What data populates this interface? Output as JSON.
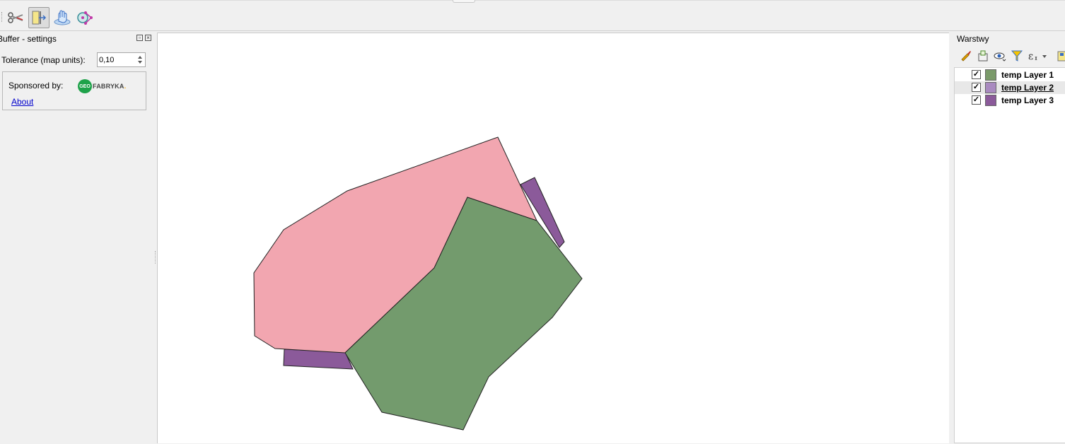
{
  "toolbar": {
    "buttons": [
      {
        "name": "scissors-icon"
      },
      {
        "name": "split-view-icon",
        "active": true
      },
      {
        "name": "touch-layer-icon"
      },
      {
        "name": "node-tool-icon"
      }
    ]
  },
  "buffer_panel": {
    "title": "Buffer - settings",
    "tolerance_label": "Tolerance (map units):",
    "tolerance_value": "0,10",
    "sponsored_label": "Sponsored by:",
    "logo_geo": "GEO",
    "logo_rest": "FABRYKA",
    "logo_dot": ".",
    "about_link": "About"
  },
  "layers_panel": {
    "title": "Warstwy",
    "layers": [
      {
        "name": "temp Layer 1",
        "checked": true,
        "color": "#7a9a6a"
      },
      {
        "name": "temp Layer 2",
        "checked": true,
        "color": "#f2a6b0",
        "selected": true
      },
      {
        "name": "temp Layer 3",
        "checked": true,
        "color": "#8b5a9a"
      }
    ]
  },
  "map": {
    "colors": {
      "green": "#739b6d",
      "pink": "#f2a6b0",
      "purple": "#8b5a9a"
    }
  }
}
